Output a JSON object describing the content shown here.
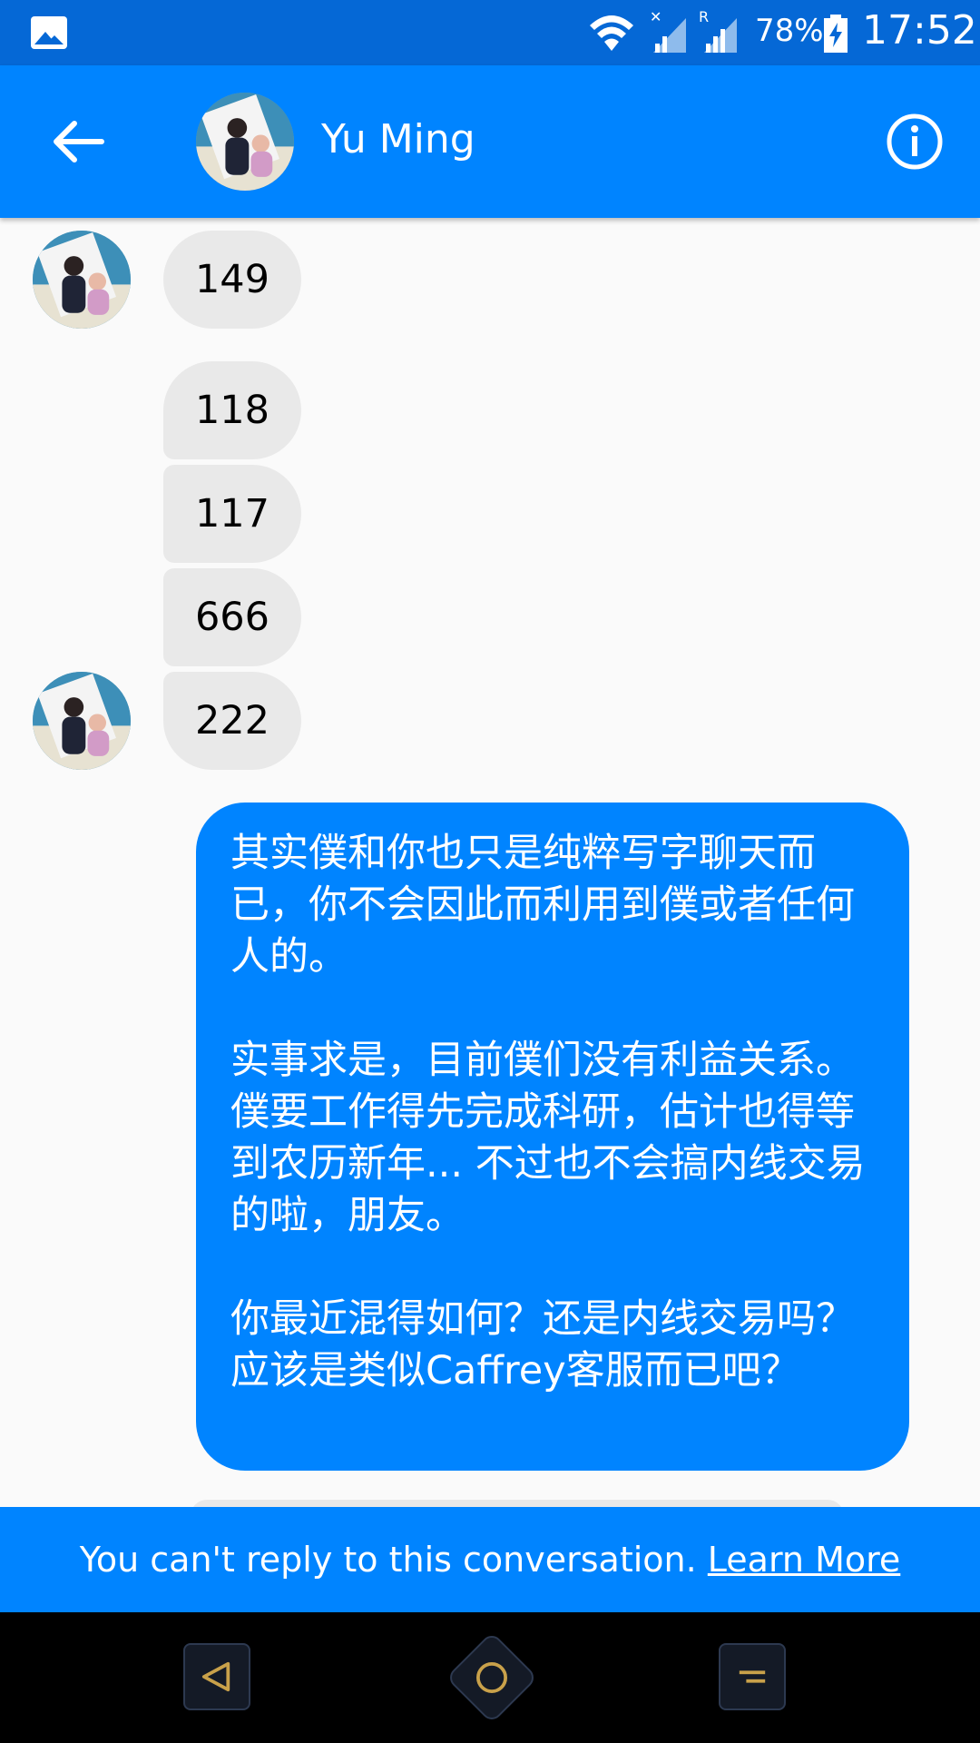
{
  "status_bar": {
    "battery": "78%",
    "time": "17:52",
    "icons": [
      "gallery-icon",
      "wifi-icon",
      "signal-icon",
      "signal-roaming-icon",
      "battery-charging-icon"
    ]
  },
  "header": {
    "contact_name": "Yu Ming",
    "back_icon": "arrow-left-icon",
    "info_icon": "info-icon"
  },
  "messages": [
    {
      "from": "Yu Ming",
      "text": "149"
    },
    {
      "from": "Yu Ming",
      "text": "118"
    },
    {
      "from": "Yu Ming",
      "text": "117"
    },
    {
      "from": "Yu Ming",
      "text": "666"
    },
    {
      "from": "Yu Ming",
      "text": "222"
    },
    {
      "from": "me",
      "paragraphs": [
        "其实僕和你也只是纯粹写字聊天而已，你不会因此而利用到僕或者任何人的。",
        "实事求是，目前僕们没有利益关系。僕要工作得先完成科研，估计也得等到农历新年... 不过也不会搞内线交易的啦，朋友。",
        "你最近混得如何？还是内线交易吗？应该是类似Caffrey客服而已吧？"
      ]
    }
  ],
  "banner": {
    "text": "You can't reply to this conversation.",
    "link": "Learn More"
  },
  "colors": {
    "status_bar": "#0568d6",
    "header": "#0084ff",
    "incoming_bubble": "#e9e9e9",
    "outgoing_bubble": "#0084ff"
  }
}
